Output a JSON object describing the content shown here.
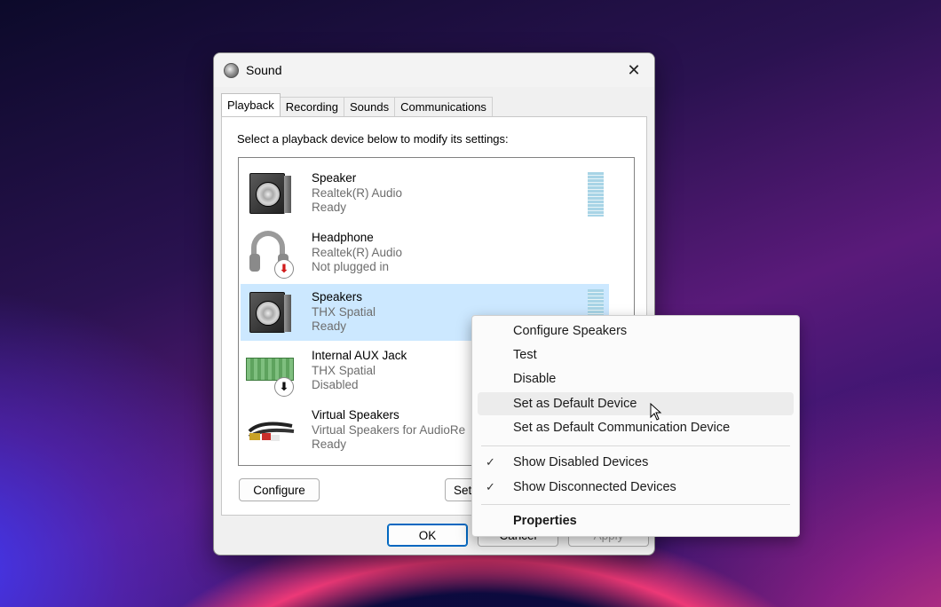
{
  "window": {
    "title": "Sound",
    "close_glyph": "✕"
  },
  "tabs": [
    {
      "label": "Playback",
      "active": true
    },
    {
      "label": "Recording",
      "active": false
    },
    {
      "label": "Sounds",
      "active": false
    },
    {
      "label": "Communications",
      "active": false
    }
  ],
  "playback": {
    "instruction": "Select a playback device below to modify its settings:",
    "devices": [
      {
        "name": "Speaker",
        "driver": "Realtek(R) Audio",
        "status": "Ready",
        "icon": "speaker-icon"
      },
      {
        "name": "Headphone",
        "driver": "Realtek(R) Audio",
        "status": "Not plugged in",
        "icon": "headphone-icon"
      },
      {
        "name": "Speakers",
        "driver": "THX Spatial",
        "status": "Ready",
        "icon": "speaker-icon",
        "selected": true
      },
      {
        "name": "Internal AUX Jack",
        "driver": "THX Spatial",
        "status": "Disabled",
        "icon": "circuit-board-icon"
      },
      {
        "name": "Virtual Speakers",
        "driver": "Virtual Speakers for AudioRe",
        "status": "Ready",
        "icon": "rca-cable-icon"
      }
    ],
    "configure_label": "Configure",
    "set_default_label": "Set"
  },
  "footer": {
    "ok_label": "OK",
    "cancel_label": "Cancel",
    "apply_label": "Apply"
  },
  "context_menu": {
    "items": [
      {
        "label": "Configure Speakers"
      },
      {
        "label": "Test"
      },
      {
        "label": "Disable"
      },
      {
        "label": "Set as Default Device",
        "hovered": true
      },
      {
        "label": "Set as Default Communication Device"
      }
    ],
    "toggles": [
      {
        "label": "Show Disabled Devices",
        "checked": true
      },
      {
        "label": "Show Disconnected Devices",
        "checked": true
      }
    ],
    "properties_label": "Properties",
    "check_glyph": "✓"
  },
  "colors": {
    "selection": "#cce8ff",
    "accent": "#0067c0",
    "arrow_red": "#d11a1a"
  }
}
